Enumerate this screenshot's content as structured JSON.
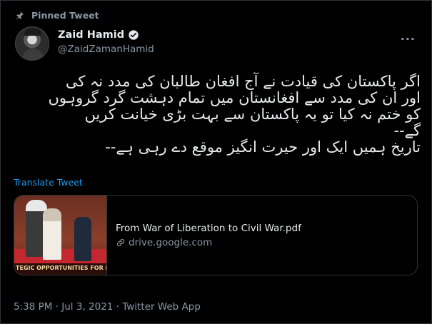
{
  "pinned": {
    "label": "Pinned Tweet"
  },
  "author": {
    "display_name": "Zaid Hamid",
    "handle": "@ZaidZamanHamid"
  },
  "more_menu": {
    "label": "···"
  },
  "tweet": {
    "lines": [
      "اگر پاکستان کی قیادت نے آج افغان طالبان کی مدد نہ کی",
      "اور ان کی مدد سے افغانستان میں تمام دہشت گرد گروہوں",
      "کو ختم نہ کیا تو یہ پاکستان سے بہت بڑی خیانت کریں",
      "گے--",
      "تاریخ ہمیں ایک اور حیرت انگیز موقع دے رہی ہے--"
    ]
  },
  "translate": {
    "label": "Translate Tweet"
  },
  "card": {
    "title": "From War of Liberation to Civil War.pdf",
    "domain": "drive.google.com",
    "thumb_caption": "TEGIC OPPORTUNITIES FOR PAKISTA"
  },
  "meta": {
    "timestamp": "5:38 PM · Jul 3, 2021 · Twitter Web App"
  },
  "colors": {
    "accent": "#1d9bf0",
    "muted": "#8b98a5",
    "text": "#e7e9ea",
    "background": "#000000"
  }
}
